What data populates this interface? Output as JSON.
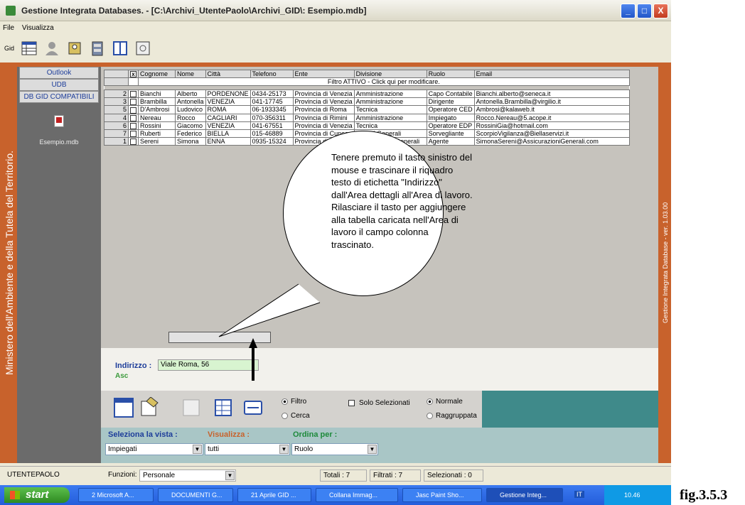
{
  "window": {
    "title": "Gestione Integrata Databases. - [C:\\Archivi_UtentePaolo\\Archivi_GID\\: Esempio.mdb]",
    "btn_min": "_",
    "btn_max": "□",
    "btn_close": "X"
  },
  "menu": [
    "File",
    "Visualizza"
  ],
  "toolbar": {
    "gid_label": "Gid"
  },
  "side_text_left": "Ministero dell'Ambiente e della Tutela del Territorio.",
  "side_text_right": "Gestione Integrata Database - ver. 1.03.00",
  "left_panel": {
    "buttons": [
      "Outlook",
      "UDB",
      "DB GID COMPATIBILI"
    ],
    "file": "Esempio.mdb"
  },
  "grid": {
    "headers": [
      "Cognome",
      "Nome",
      "Città",
      "Telefono",
      "Ente",
      "Divisione",
      "Ruolo",
      "Email"
    ],
    "filter_text": "Filtro ATTIVO - Click qui per modificare.",
    "rows": [
      {
        "n": "2",
        "cells": [
          "Bianchi",
          "Alberto",
          "PORDENONE",
          "0434-25173",
          "Provincia di Venezia",
          "Amministrazione",
          "Capo Contabile",
          "Bianchi.alberto@seneca.it"
        ]
      },
      {
        "n": "3",
        "cells": [
          "Brambilla",
          "Antonella",
          "VENEZIA",
          "041-17745",
          "Provincia di Venezia",
          "Amministrazione",
          "Dirigente",
          "Antonella.Brambilla@virgilio.it"
        ]
      },
      {
        "n": "5",
        "cells": [
          "D'Ambrosi",
          "Ludovico",
          "ROMA",
          "06-1933345",
          "Provincia di Roma",
          "Tecnica",
          "Operatore CED",
          "Ambrosi@kalaweb.it"
        ]
      },
      {
        "n": "4",
        "cells": [
          "Nereau",
          "Rocco",
          "CAGLIARI",
          "070-356311",
          "Provincia di Rimini",
          "Amministrazione",
          "Impiegato",
          "Rocco.Nereau@5.acope.it"
        ]
      },
      {
        "n": "6",
        "cells": [
          "Rossini",
          "Giacomo",
          "VENEZIA",
          "041-67551",
          "Provincia di Venezia",
          "Tecnica",
          "Operatore EDP",
          "RossiniGia@hotmail.com"
        ]
      },
      {
        "n": "7",
        "cells": [
          "Ruberti",
          "Federico",
          "BIELLA",
          "015-46889",
          "Provincia di Cuneo",
          "Servizi Generali",
          "Sorvegliante",
          "ScorpioVigilanza@Biellaservizi.it"
        ]
      },
      {
        "n": "1",
        "cells": [
          "Sereni",
          "Simona",
          "ENNA",
          "0935-15324",
          "Provincia di Enna",
          "Assicurazioni Generali",
          "Agente",
          "SimonaSereni@AssicurazioniGenerali.com"
        ]
      }
    ]
  },
  "callout": "Tenere premuto il tasto sinistro del mouse e trascinare il riquadro testo di etichetta \"Indirizzo\" dall'Area dettagli all'Area di lavoro. Rilasciare il tasto per aggiungere alla tabella caricata nell'Area di lavoro  il campo colonna trascinato.",
  "detail": {
    "label": "Indirizzo :",
    "value": "Viale Roma, 56",
    "sort": "Asc"
  },
  "options": {
    "filtro": "Filtro",
    "cerca": "Cerca",
    "solo": "Solo Selezionati",
    "normale": "Normale",
    "raggruppata": "Raggruppata"
  },
  "selectors": {
    "vista_label": "Seleziona la vista :",
    "vista_value": "Impiegati",
    "visualizza_label": "Visualizza :",
    "visualizza_value": "tutti",
    "ordina_label": "Ordina per :",
    "ordina_value": "Ruolo"
  },
  "status": {
    "user": "UTENTEPAOLO",
    "funzioni_label": "Funzioni:",
    "funzioni_value": "Personale",
    "totali": "Totali :  7",
    "filtrati": "Filtrati :  7",
    "selezionati": "Selezionati :  0"
  },
  "taskbar": {
    "start": "start",
    "tasks": [
      "2 Microsoft A...",
      "DOCUMENTI G...",
      "21 Aprile GID ...",
      "Collana Immag...",
      "Jasc Paint Sho...",
      "Gestione Integ..."
    ],
    "lang": "IT",
    "time": "10.46"
  },
  "figure_label": "fig.3.5.3",
  "colors": {
    "orange": "#c8622c",
    "teal": "#3f8a8a",
    "panel": "#6b6b6b"
  }
}
